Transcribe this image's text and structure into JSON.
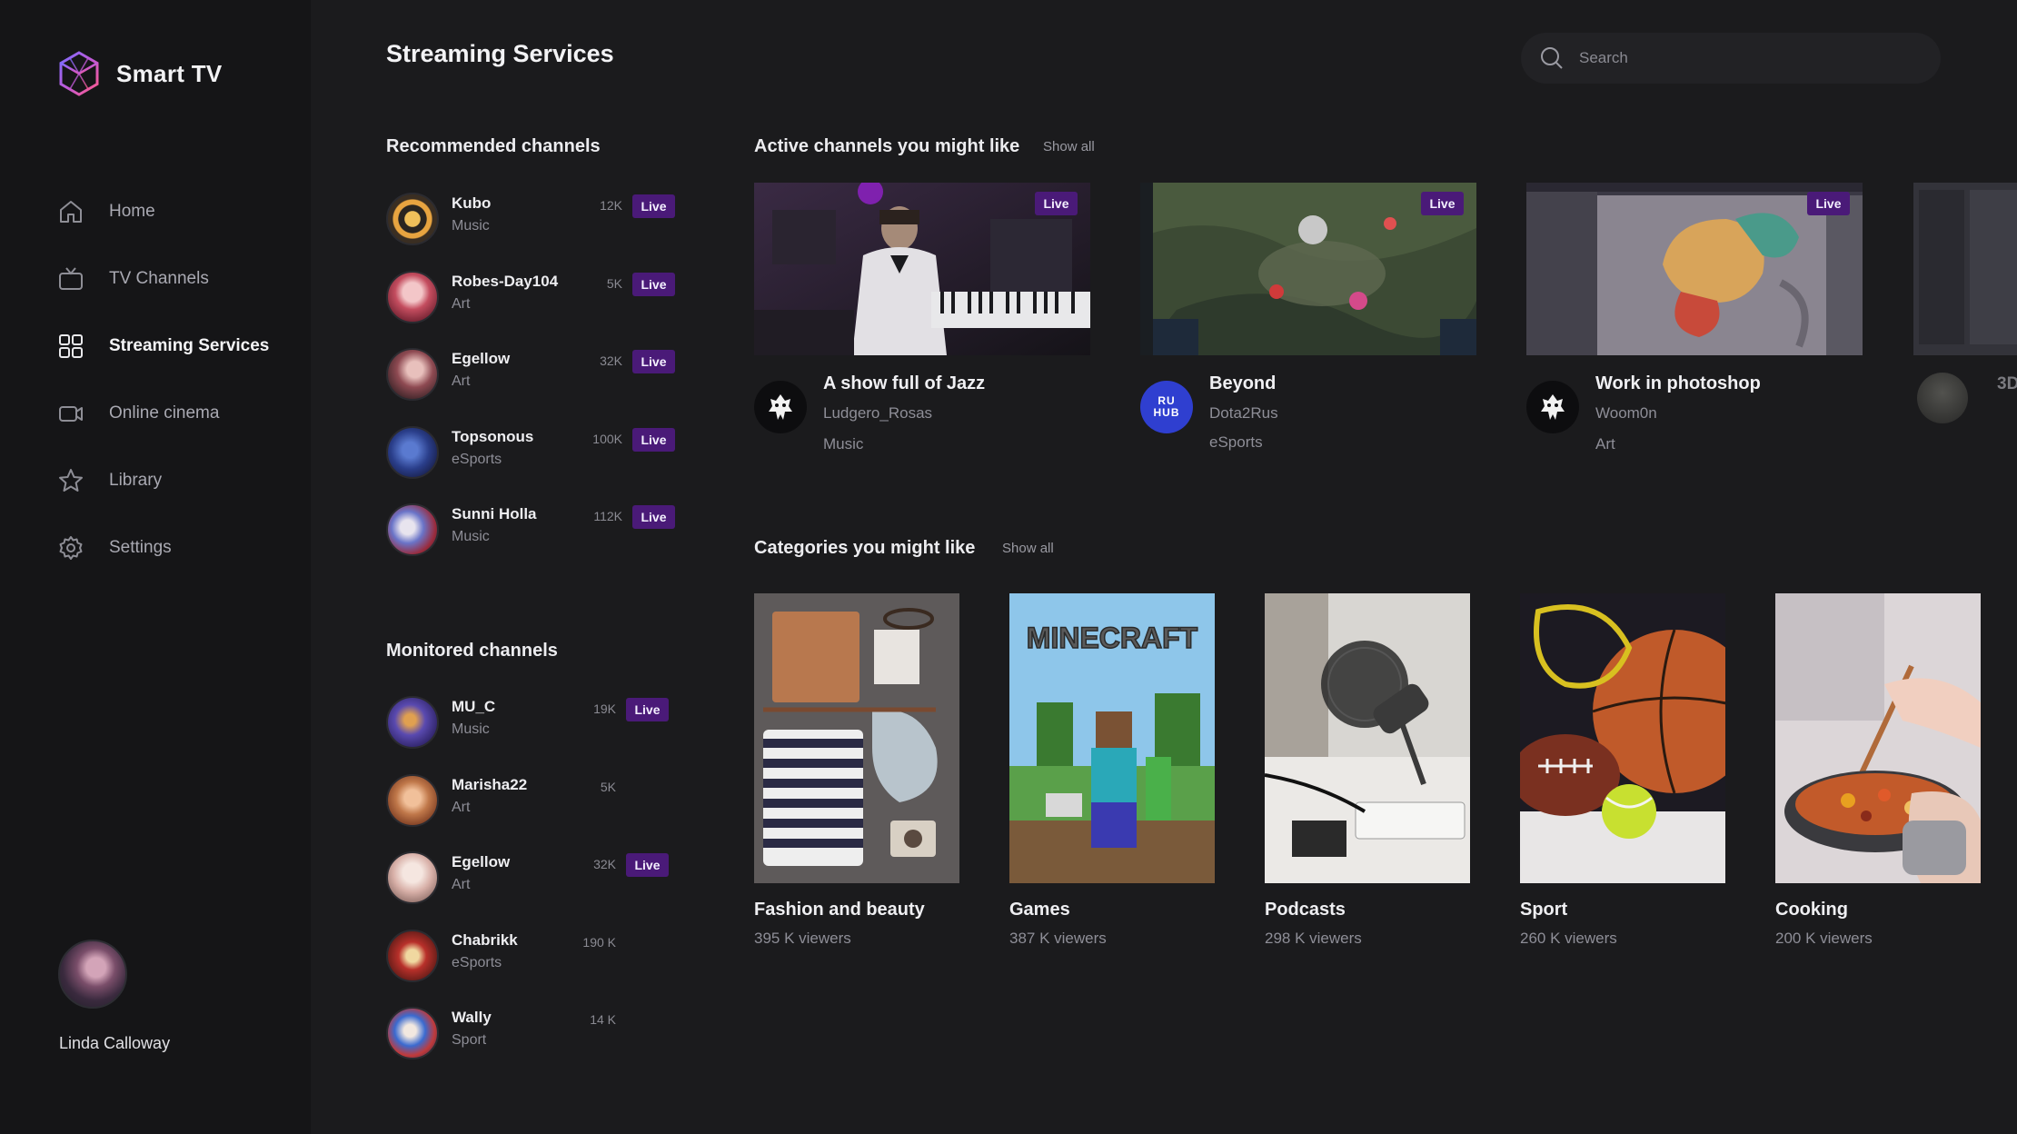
{
  "app": {
    "name": "Smart TV"
  },
  "nav": [
    {
      "label": "Home",
      "icon": "home-icon"
    },
    {
      "label": "TV Channels",
      "icon": "tv-icon"
    },
    {
      "label": "Streaming Services",
      "icon": "grid-icon",
      "active": true
    },
    {
      "label": "Online cinema",
      "icon": "video-camera-icon"
    },
    {
      "label": "Library",
      "icon": "star-icon"
    },
    {
      "label": "Settings",
      "icon": "gear-icon"
    }
  ],
  "profile": {
    "name": "Linda Calloway"
  },
  "header": {
    "title": "Streaming Services"
  },
  "search": {
    "placeholder": "Search"
  },
  "recommended": {
    "title": "Recommended channels",
    "items": [
      {
        "name": "Kubo",
        "category": "Music",
        "viewers": "12K",
        "live": "Live"
      },
      {
        "name": "Robes-Day104",
        "category": "Art",
        "viewers": "5K",
        "live": "Live"
      },
      {
        "name": "Egellow",
        "category": "Art",
        "viewers": "32K",
        "live": "Live"
      },
      {
        "name": "Topsonous",
        "category": "eSports",
        "viewers": "100K",
        "live": "Live"
      },
      {
        "name": "Sunni Holla",
        "category": "Music",
        "viewers": "112K",
        "live": "Live"
      }
    ]
  },
  "monitored": {
    "title": "Monitored channels",
    "items": [
      {
        "name": "MU_C",
        "category": "Music",
        "viewers": "19K",
        "live": "Live"
      },
      {
        "name": "Marisha22",
        "category": "Art",
        "viewers": "5K"
      },
      {
        "name": "Egellow",
        "category": "Art",
        "viewers": "32K",
        "live": "Live"
      },
      {
        "name": "Chabrikk",
        "category": "eSports",
        "viewers": "190 K"
      },
      {
        "name": "Wally",
        "category": "Sport",
        "viewers": "14 K"
      }
    ]
  },
  "active": {
    "title": "Active channels you might like",
    "show_all": "Show all",
    "cards": [
      {
        "title": "A show full of Jazz",
        "channel": "Ludgero_Rosas",
        "category": "Music",
        "live": "Live"
      },
      {
        "title": "Beyond",
        "channel": "Dota2Rus",
        "category": "eSports",
        "live": "Live",
        "avatar_text": "RU HUB"
      },
      {
        "title": "Work in photoshop",
        "channel": "Woom0n",
        "category": "Art",
        "live": "Live"
      }
    ],
    "peek_text": "3D"
  },
  "categories": {
    "title": "Categories you might like",
    "show_all": "Show all",
    "cards": [
      {
        "title": "Fashion and beauty",
        "viewers": "395 K viewers"
      },
      {
        "title": "Games",
        "viewers": "387 K viewers",
        "image_text": "MINECRAFT"
      },
      {
        "title": "Podcasts",
        "viewers": "298 K viewers"
      },
      {
        "title": "Sport",
        "viewers": "260 K viewers"
      },
      {
        "title": "Cooking",
        "viewers": "200 K viewers"
      }
    ]
  },
  "colors": {
    "accent": "#4a1a78",
    "background": "#1b1b1d",
    "sidebar": "#151517"
  }
}
